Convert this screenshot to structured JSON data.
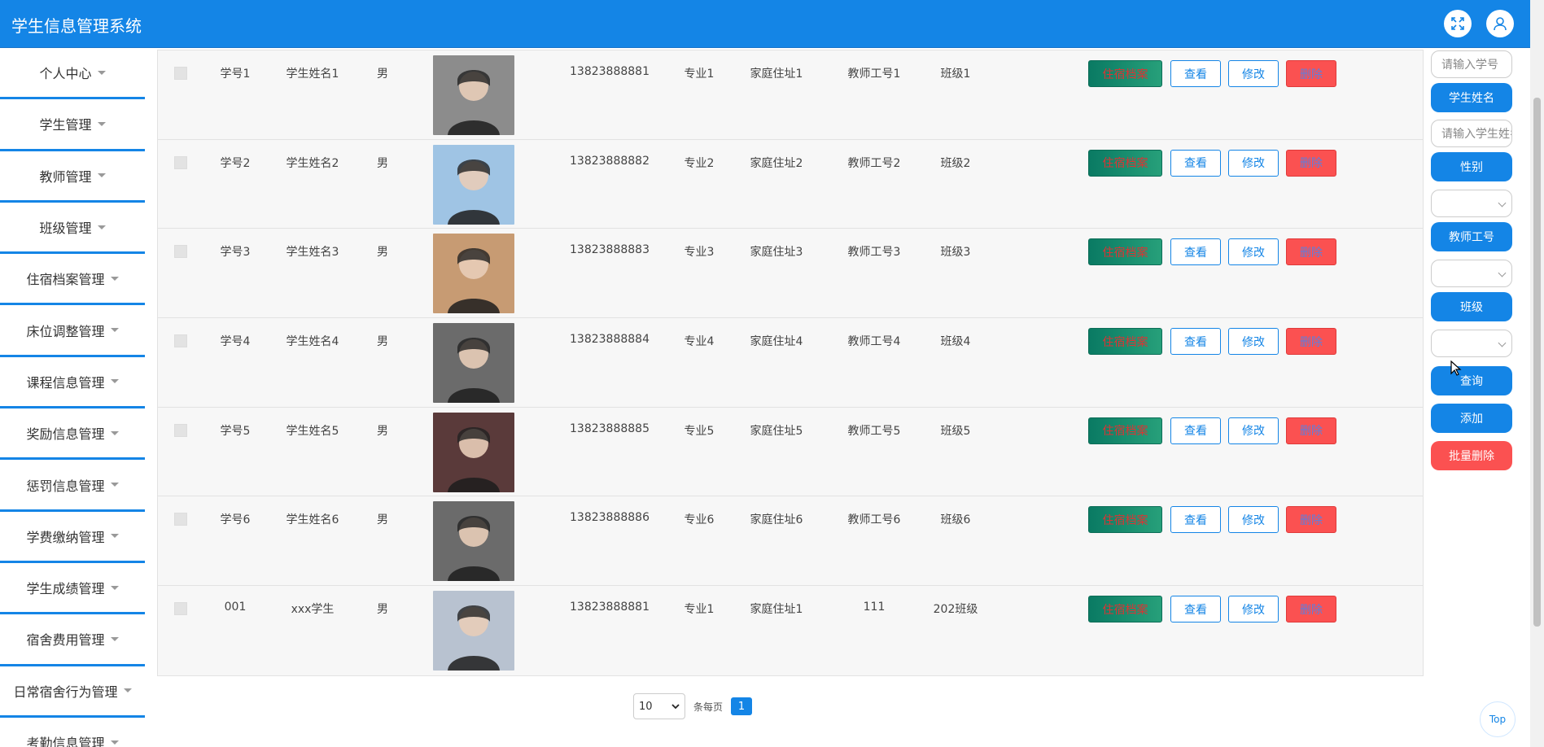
{
  "app": {
    "title": "学生信息管理系统"
  },
  "sidebar": {
    "items": [
      {
        "label": "个人中心"
      },
      {
        "label": "学生管理"
      },
      {
        "label": "教师管理"
      },
      {
        "label": "班级管理"
      },
      {
        "label": "住宿档案管理"
      },
      {
        "label": "床位调整管理"
      },
      {
        "label": "课程信息管理"
      },
      {
        "label": "奖励信息管理"
      },
      {
        "label": "惩罚信息管理"
      },
      {
        "label": "学费缴纳管理"
      },
      {
        "label": "学生成绩管理"
      },
      {
        "label": "宿舍费用管理"
      },
      {
        "label": "日常宿舍行为管理"
      },
      {
        "label": "考勤信息管理"
      }
    ]
  },
  "table": {
    "rows": [
      {
        "id": "学号1",
        "name": "学生姓名1",
        "sex": "男",
        "phone": "13823888881",
        "major": "专业1",
        "address": "家庭住址1",
        "teacher": "教师工号1",
        "class": "班级1",
        "photo_color": "#8c8c8c"
      },
      {
        "id": "学号2",
        "name": "学生姓名2",
        "sex": "男",
        "phone": "13823888882",
        "major": "专业2",
        "address": "家庭住址2",
        "teacher": "教师工号2",
        "class": "班级2",
        "photo_color": "#9fc4e4"
      },
      {
        "id": "学号3",
        "name": "学生姓名3",
        "sex": "男",
        "phone": "13823888883",
        "major": "专业3",
        "address": "家庭住址3",
        "teacher": "教师工号3",
        "class": "班级3",
        "photo_color": "#c79b73"
      },
      {
        "id": "学号4",
        "name": "学生姓名4",
        "sex": "男",
        "phone": "13823888884",
        "major": "专业4",
        "address": "家庭住址4",
        "teacher": "教师工号4",
        "class": "班级4",
        "photo_color": "#6b6b6b"
      },
      {
        "id": "学号5",
        "name": "学生姓名5",
        "sex": "男",
        "phone": "13823888885",
        "major": "专业5",
        "address": "家庭住址5",
        "teacher": "教师工号5",
        "class": "班级5",
        "photo_color": "#5a3a3a"
      },
      {
        "id": "学号6",
        "name": "学生姓名6",
        "sex": "男",
        "phone": "13823888886",
        "major": "专业6",
        "address": "家庭住址6",
        "teacher": "教师工号6",
        "class": "班级6",
        "photo_color": "#6b6b6b"
      },
      {
        "id": "001",
        "name": "xxx学生",
        "sex": "男",
        "phone": "13823888881",
        "major": "专业1",
        "address": "家庭住址1",
        "teacher": "111",
        "class": "202班级",
        "photo_color": "#b8c2d0"
      }
    ],
    "actions": {
      "dorm": "住宿档案",
      "view": "查看",
      "edit": "修改",
      "delete": "删除"
    }
  },
  "pagination": {
    "page_size": "10",
    "per_page_label": "条每页",
    "current_page": "1"
  },
  "search": {
    "id_placeholder": "请输入学号",
    "name_label": "学生姓名",
    "name_placeholder": "请输入学生姓名",
    "sex_label": "性别",
    "teacher_label": "教师工号",
    "class_label": "班级",
    "query_button": "查询",
    "add_button": "添加",
    "batch_delete_button": "批量删除"
  },
  "top_button": "Top",
  "colors": {
    "primary": "#1485e6",
    "danger": "#fb5151",
    "dorm_btn": "#0a7a63"
  }
}
